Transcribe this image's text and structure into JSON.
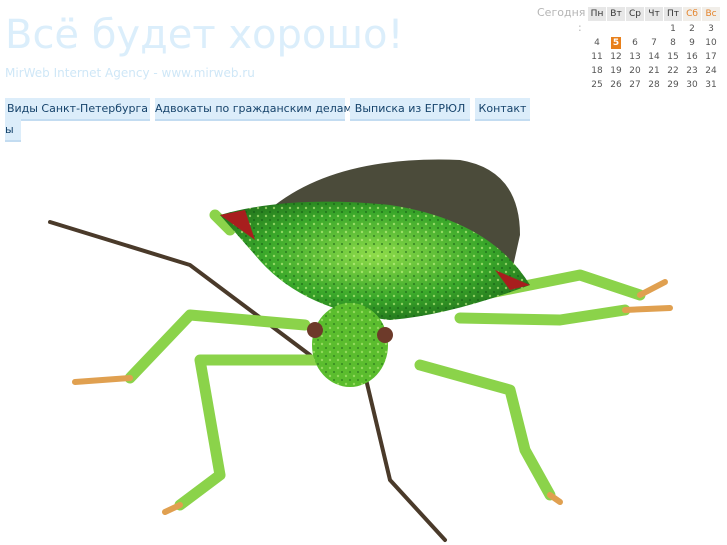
{
  "header": {
    "title": "Всё будет хорошо!",
    "subtitle": "MirWeb Internet Agency - www.mirweb.ru"
  },
  "calendar": {
    "today_label": "Сегодня",
    "today_colon": ":",
    "weekdays": [
      "Пн",
      "Вт",
      "Ср",
      "Чт",
      "Пт",
      "Сб",
      "Вс"
    ],
    "weeks": [
      [
        "",
        "",
        "",
        "",
        "1",
        "2",
        "3"
      ],
      [
        "4",
        "5",
        "6",
        "7",
        "8",
        "9",
        "10"
      ],
      [
        "11",
        "12",
        "13",
        "14",
        "15",
        "16",
        "17"
      ],
      [
        "18",
        "19",
        "20",
        "21",
        "22",
        "23",
        "24"
      ],
      [
        "25",
        "26",
        "27",
        "28",
        "29",
        "30",
        "31"
      ]
    ],
    "today": "5",
    "accent_color": "#e8801c"
  },
  "nav": {
    "items": [
      "Виды Санкт-Петербурга",
      "Адвокаты по гражданским делам",
      "Выписка из ЕГРЮЛ",
      "Контакт",
      "ы"
    ]
  },
  "image": {
    "icon": "green-shield-bug-image"
  }
}
